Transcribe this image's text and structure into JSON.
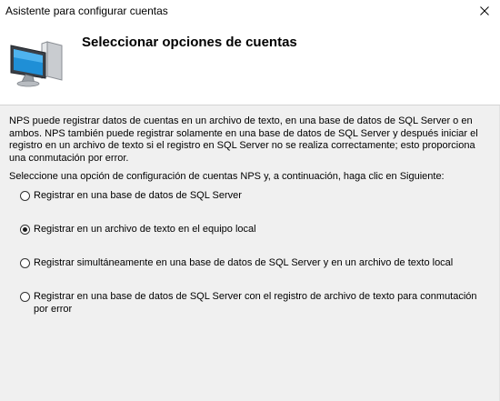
{
  "window": {
    "title": "Asistente para configurar cuentas"
  },
  "header": {
    "title": "Seleccionar opciones de cuentas",
    "icon": "computer-monitor-icon"
  },
  "content": {
    "description": "NPS puede registrar datos de cuentas en un archivo de texto, en una base de datos de SQL Server o en ambos. NPS también puede registrar solamente en una base de datos de SQL Server y después iniciar el registro en un archivo de texto si el registro en SQL Server no se realiza correctamente; esto proporciona una conmutación por error.",
    "prompt": "Seleccione una opción de configuración de cuentas NPS y, a continuación, haga clic en Siguiente:",
    "options": [
      {
        "label": "Registrar en una base de datos de SQL Server",
        "selected": false
      },
      {
        "label": "Registrar en un archivo de texto en el equipo local",
        "selected": true
      },
      {
        "label": "Registrar simultáneamente en una base de datos de SQL Server y en un archivo de texto local",
        "selected": false
      },
      {
        "label": "Registrar en una base de datos de SQL Server con el registro de archivo de texto para conmutación por error",
        "selected": false
      }
    ]
  }
}
